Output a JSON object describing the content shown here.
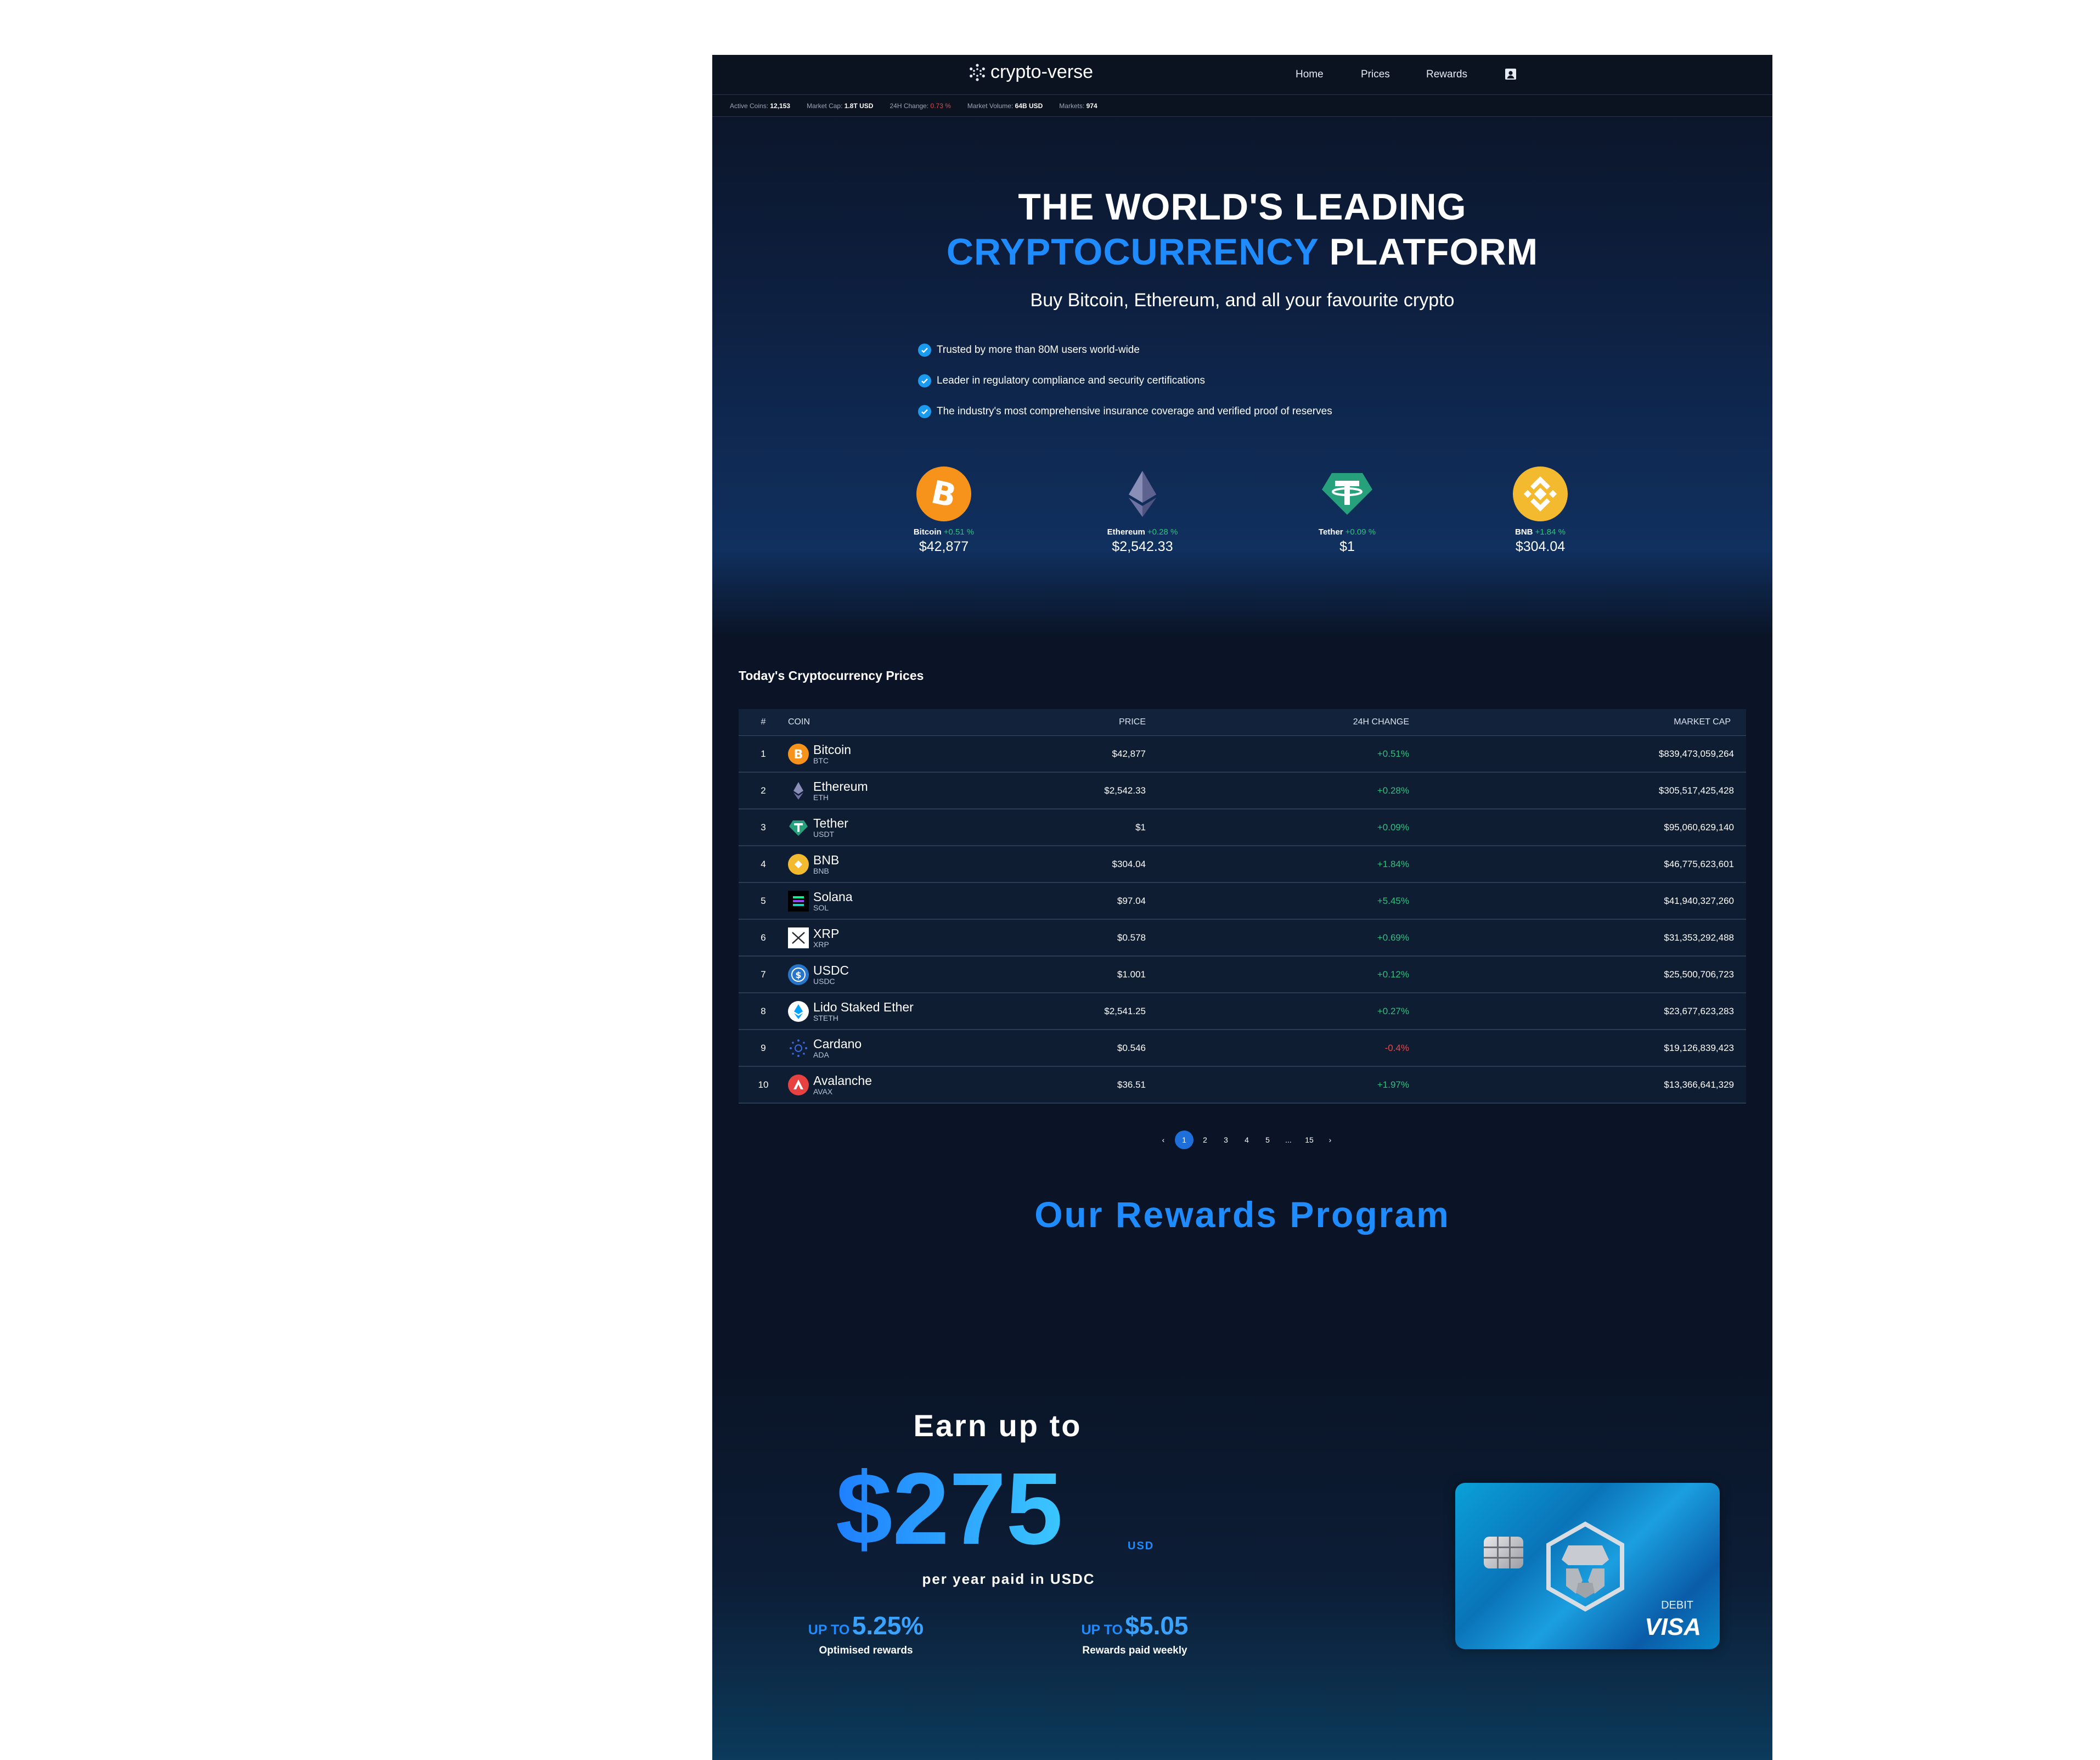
{
  "header": {
    "logo_text": "crypto-verse",
    "nav": [
      "Home",
      "Prices",
      "Rewards"
    ]
  },
  "stats": {
    "active_coins_label": "Active Coins:",
    "active_coins": "12,153",
    "market_cap_label": "Market Cap:",
    "market_cap": "1.8T USD",
    "change_label": "24H Change:",
    "change": "0.73 %",
    "volume_label": "Market Volume:",
    "volume": "64B USD",
    "markets_label": "Markets:",
    "markets": "974"
  },
  "hero": {
    "line1": "THE WORLD'S LEADING",
    "line2_accent": "CRYPTOCURRENCY",
    "line2_rest": " PLATFORM",
    "subtitle": "Buy Bitcoin, Ethereum, and all your favourite crypto",
    "bullets": [
      "Trusted by more than 80M users world-wide",
      "Leader in regulatory compliance and security certifications",
      "The industry's most comprehensive insurance coverage and verified proof of reserves"
    ],
    "coins": [
      {
        "name": "Bitcoin",
        "change": "+0.51 %",
        "price": "$42,877"
      },
      {
        "name": "Ethereum",
        "change": "+0.28 %",
        "price": "$2,542.33"
      },
      {
        "name": "Tether",
        "change": "+0.09 %",
        "price": "$1"
      },
      {
        "name": "BNB",
        "change": "+1.84 %",
        "price": "$304.04"
      }
    ]
  },
  "prices": {
    "title": "Today's Cryptocurrency Prices",
    "columns": [
      "#",
      "COIN",
      "PRICE",
      "24H CHANGE",
      "MARKET CAP"
    ],
    "rows": [
      {
        "rank": "1",
        "name": "Bitcoin",
        "symbol": "BTC",
        "price": "$42,877",
        "change": "+0.51%",
        "cap": "$839,473,059,264",
        "icon": "bitcoin-icon",
        "color": "#f7931a"
      },
      {
        "rank": "2",
        "name": "Ethereum",
        "symbol": "ETH",
        "price": "$2,542.33",
        "change": "+0.28%",
        "cap": "$305,517,425,428",
        "icon": "ethereum-icon",
        "color": "#627eea"
      },
      {
        "rank": "3",
        "name": "Tether",
        "symbol": "USDT",
        "price": "$1",
        "change": "+0.09%",
        "cap": "$95,060,629,140",
        "icon": "tether-icon",
        "color": "#26a17b"
      },
      {
        "rank": "4",
        "name": "BNB",
        "symbol": "BNB",
        "price": "$304.04",
        "change": "+1.84%",
        "cap": "$46,775,623,601",
        "icon": "bnb-icon",
        "color": "#f3ba2f"
      },
      {
        "rank": "5",
        "name": "Solana",
        "symbol": "SOL",
        "price": "$97.04",
        "change": "+5.45%",
        "cap": "$41,940,327,260",
        "icon": "solana-icon",
        "color": "#14f195"
      },
      {
        "rank": "6",
        "name": "XRP",
        "symbol": "XRP",
        "price": "$0.578",
        "change": "+0.69%",
        "cap": "$31,353,292,488",
        "icon": "xrp-icon",
        "color": "#ffffff"
      },
      {
        "rank": "7",
        "name": "USDC",
        "symbol": "USDC",
        "price": "$1.001",
        "change": "+0.12%",
        "cap": "$25,500,706,723",
        "icon": "usdc-icon",
        "color": "#2775ca"
      },
      {
        "rank": "8",
        "name": "Lido Staked Ether",
        "symbol": "STETH",
        "price": "$2,541.25",
        "change": "+0.27%",
        "cap": "$23,677,623,283",
        "icon": "lido-icon",
        "color": "#00a3ff"
      },
      {
        "rank": "9",
        "name": "Cardano",
        "symbol": "ADA",
        "price": "$0.546",
        "change": "-0.4%",
        "cap": "$19,126,839,423",
        "icon": "cardano-icon",
        "color": "#0033ad"
      },
      {
        "rank": "10",
        "name": "Avalanche",
        "symbol": "AVAX",
        "price": "$36.51",
        "change": "+1.97%",
        "cap": "$13,366,641,329",
        "icon": "avalanche-icon",
        "color": "#e84142"
      }
    ],
    "pager": [
      "‹",
      "1",
      "2",
      "3",
      "4",
      "5",
      "...",
      "15",
      "›"
    ]
  },
  "rewards": {
    "title": "Our Rewards Program",
    "earn": "Earn up to",
    "amount": "$275",
    "currency": "USD",
    "per_year": "per year paid in USDC",
    "stat1_prefix": "UP TO",
    "stat1_value": "5.25%",
    "stat1_label": "Optimised rewards",
    "stat2_prefix": "UP TO",
    "stat2_value": "$5.05",
    "stat2_label": "Rewards paid weekly",
    "card_debit": "DEBIT",
    "card_brand": "VISA"
  }
}
